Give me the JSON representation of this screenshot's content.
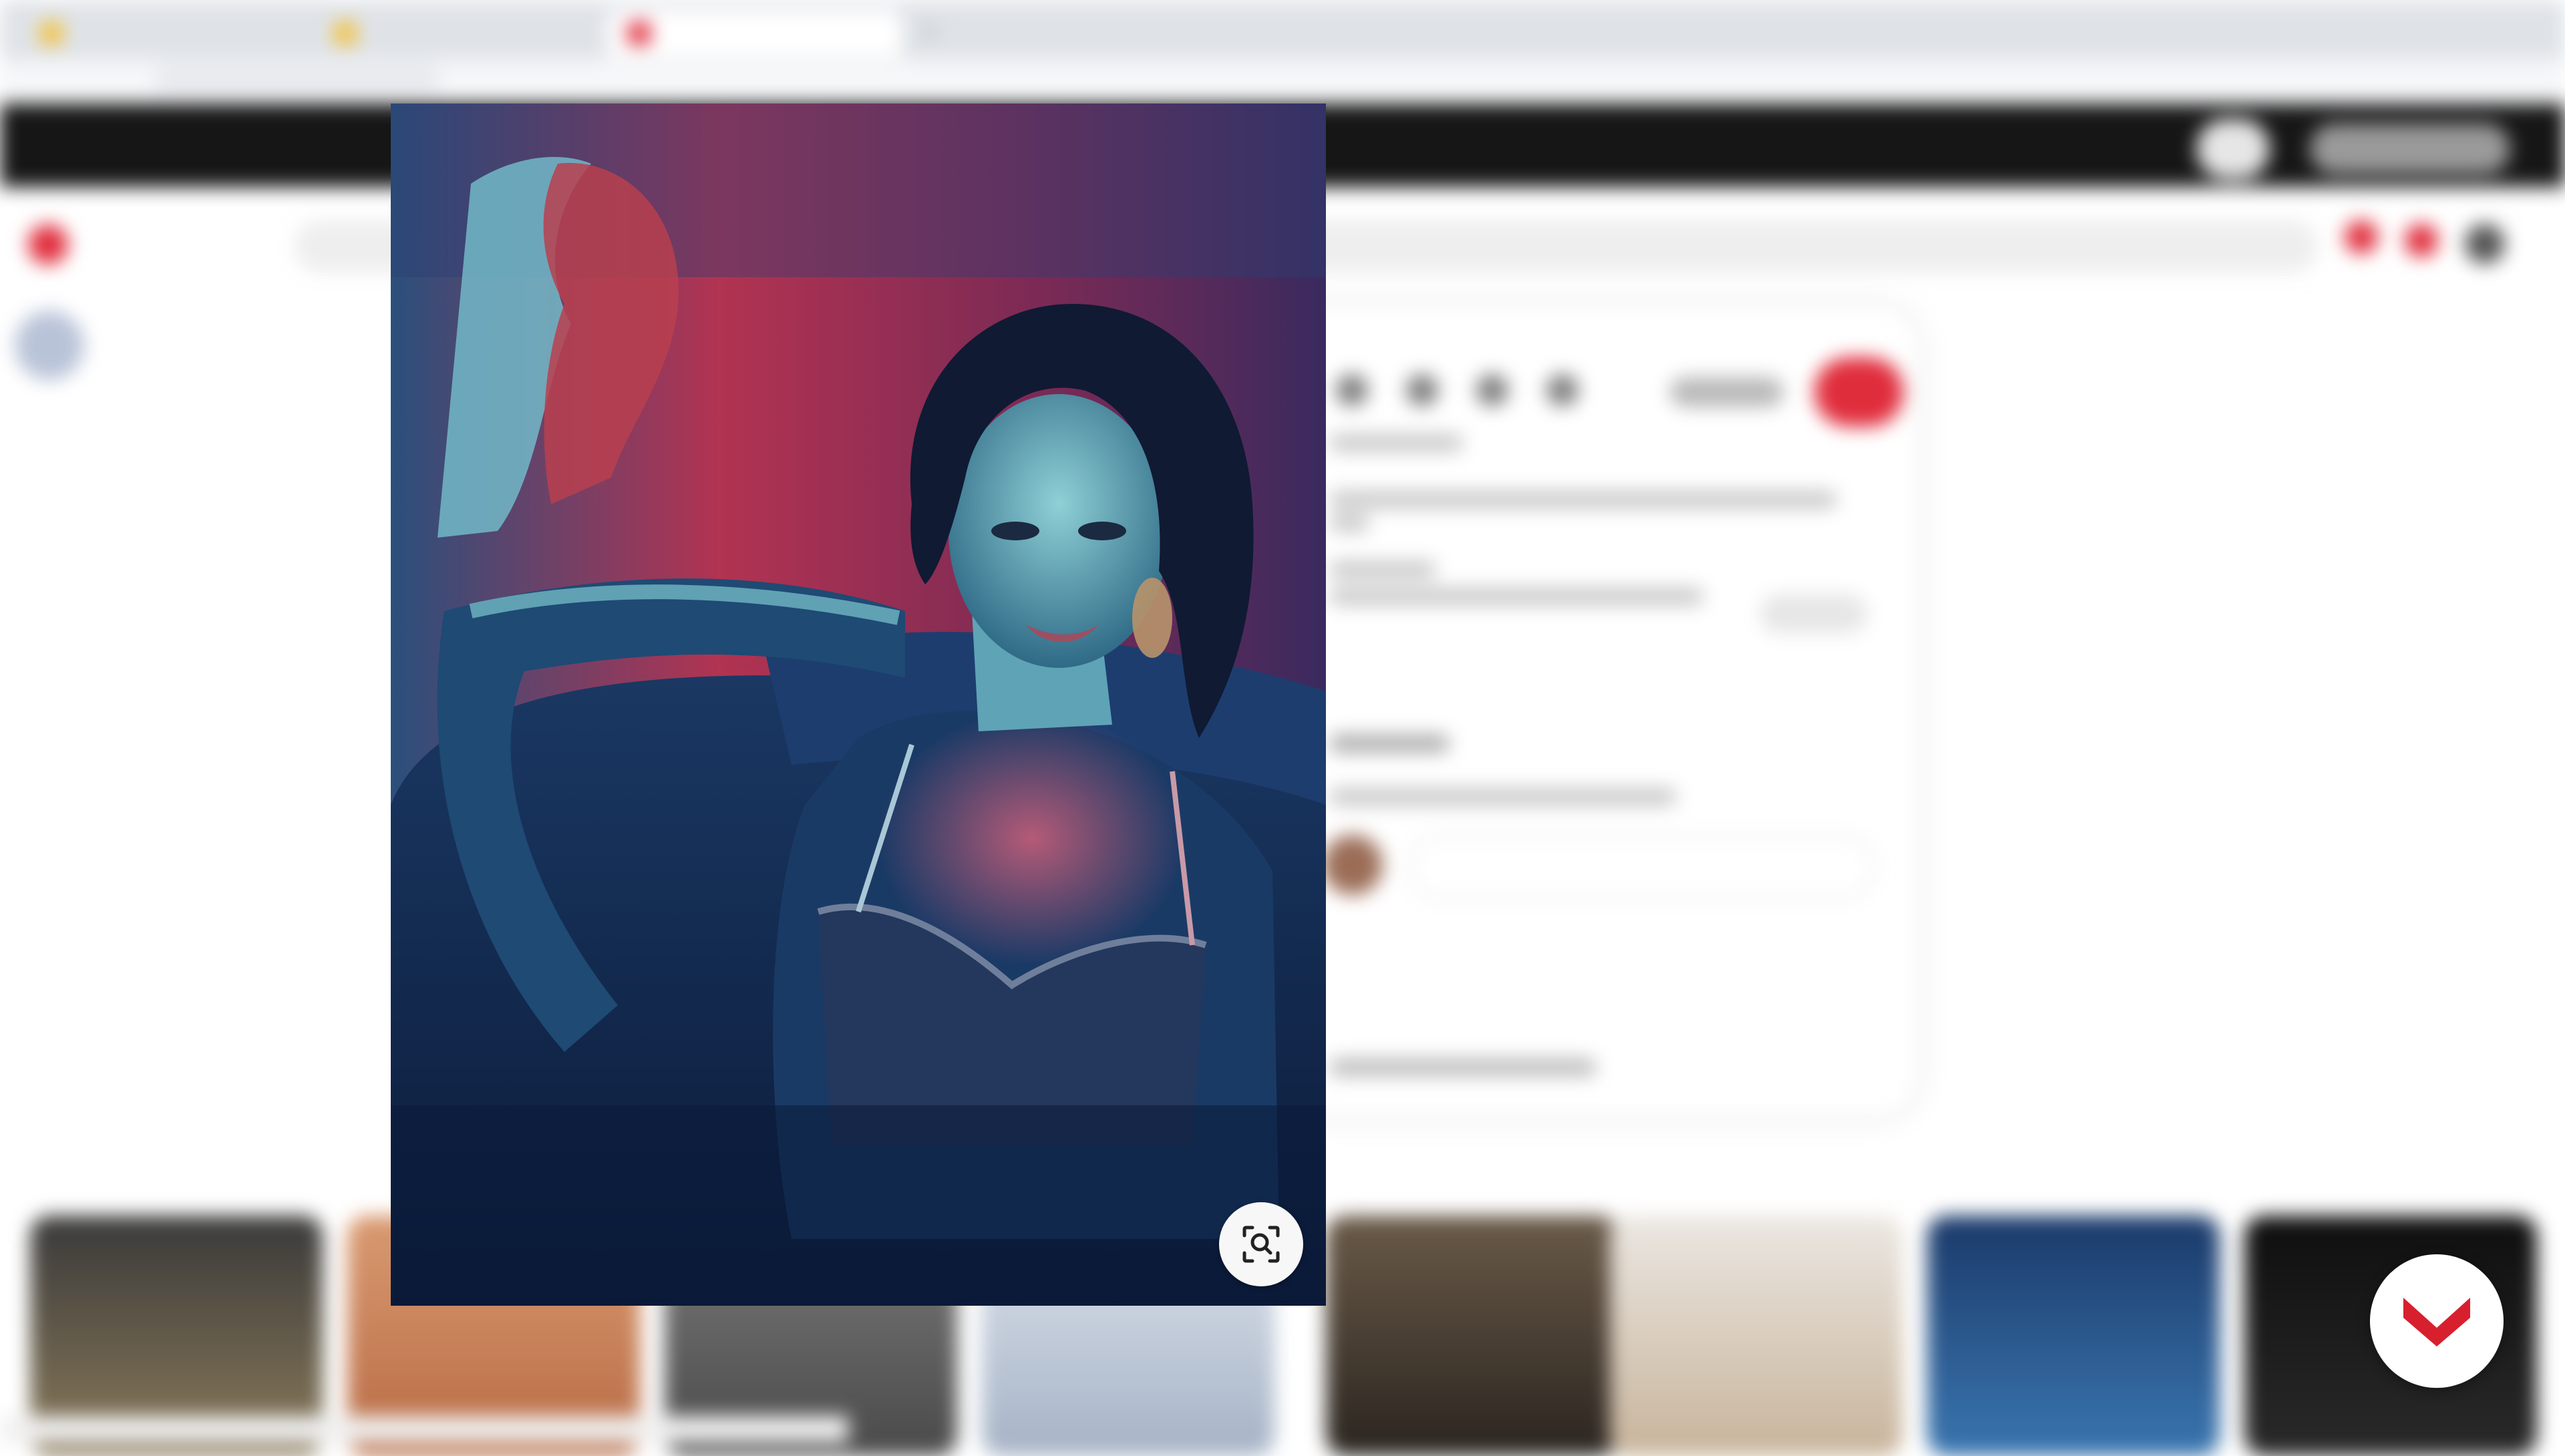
{
  "browser": {
    "tabs": [
      {
        "title": "",
        "favicon_color": "#f2c13b",
        "active": false
      },
      {
        "title": "",
        "favicon_color": "#f2c13b",
        "active": false
      },
      {
        "title": "",
        "favicon_color": "#e02d3c",
        "active": true
      }
    ],
    "new_tab_icon": "plus-icon"
  },
  "banner": {
    "text": ""
  },
  "nav": {
    "home_label": "",
    "today_label": "",
    "search_placeholder": ""
  },
  "pin": {
    "save_button_color": "#e02d3c",
    "comments_heading": ""
  },
  "viewer": {
    "visual_search_icon": "visual-search-icon",
    "alt": ""
  },
  "fab": {
    "icon": "chevron-logo-icon",
    "color": "#d81f2e"
  },
  "colors": {
    "banner_bg": "#161616",
    "brand_red": "#e02d3c"
  }
}
